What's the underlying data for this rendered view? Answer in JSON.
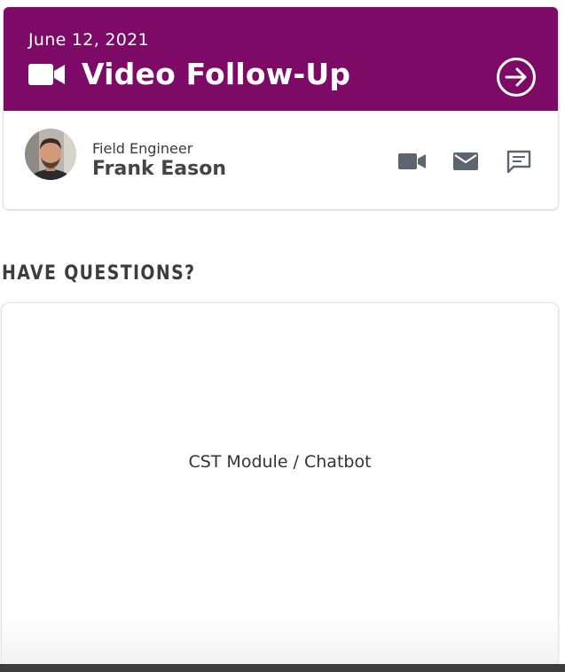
{
  "appointment": {
    "date": "June 12, 2021",
    "title": "Video Follow-Up",
    "header_color": "#7d0a66",
    "title_icon": "video-camera-icon",
    "action_icon": "arrow-right-circle-icon"
  },
  "contact": {
    "role": "Field Engineer",
    "name": "Frank Eason",
    "actions": [
      {
        "name": "video-call",
        "icon": "video-camera-icon"
      },
      {
        "name": "email",
        "icon": "envelope-icon"
      },
      {
        "name": "message",
        "icon": "chat-bubble-icon"
      }
    ]
  },
  "questions": {
    "heading": "HAVE QUESTIONS?",
    "module_label": "CST Module / Chatbot"
  }
}
